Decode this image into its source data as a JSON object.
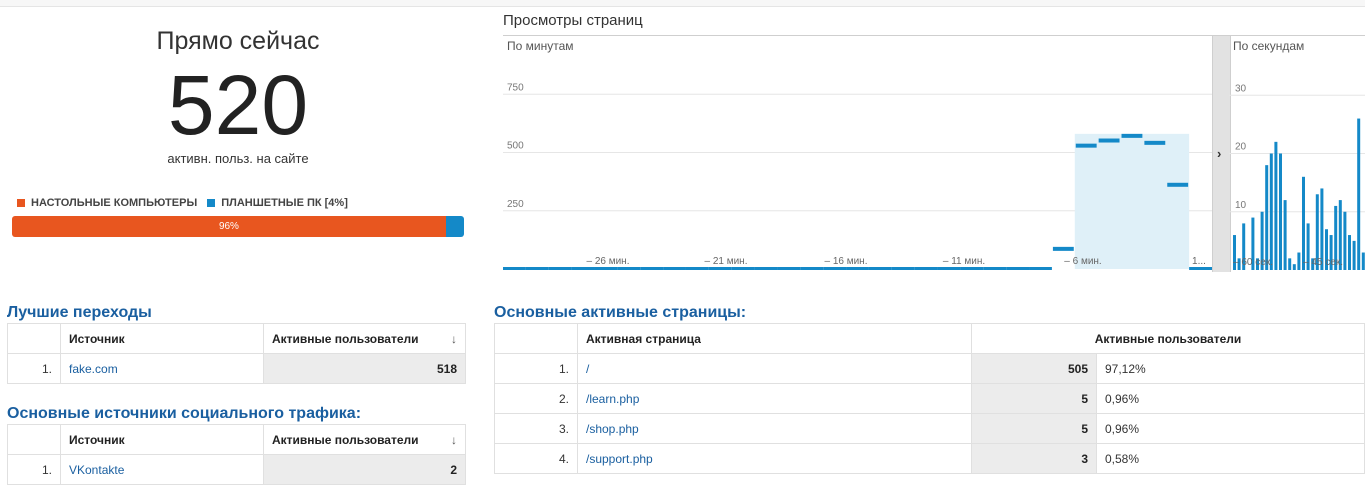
{
  "summary": {
    "title": "Прямо сейчас",
    "count": "520",
    "subtitle": "активн. польз. на сайте",
    "legend": [
      {
        "label": "НАСТОЛЬНЫЕ КОМПЬЮТЕРЫ",
        "color": "#e8561f"
      },
      {
        "label": "ПЛАНШЕТНЫЕ ПК [4%]",
        "color": "#1489c8"
      }
    ],
    "device_share": {
      "desktop_percent": 96,
      "desktop_label": "96%",
      "tablet_percent": 4
    }
  },
  "pageviews": {
    "title": "Просмотры страниц",
    "per_minute_label": "По минутам",
    "per_second_label": "По секундам"
  },
  "chart_data": [
    {
      "type": "bar",
      "title": "По минутам",
      "ylim": [
        0,
        1000
      ],
      "yticks": [
        250,
        500,
        750
      ],
      "xticks": [
        "– 26 мин.",
        "– 21 мин.",
        "– 16 мин.",
        "– 11 мин.",
        "– 6 мин.",
        "1..."
      ],
      "values": [
        0,
        0,
        0,
        0,
        0,
        0,
        0,
        0,
        0,
        0,
        0,
        0,
        0,
        0,
        0,
        0,
        0,
        0,
        0,
        0,
        0,
        0,
        0,
        0,
        95,
        538,
        560,
        580,
        550,
        370,
        0
      ],
      "color": "#1489c8",
      "highlight_fill": "#dff0f8"
    },
    {
      "type": "bar",
      "title": "По секундам",
      "ylim": [
        0,
        40
      ],
      "yticks": [
        10,
        20,
        30
      ],
      "xticks": [
        "– 60 сек.",
        "– 45 сек."
      ],
      "values": [
        6,
        2,
        8,
        0,
        9,
        2,
        10,
        18,
        20,
        22,
        20,
        12,
        2,
        1,
        3,
        16,
        8,
        2,
        13,
        14,
        7,
        6,
        11,
        12,
        10,
        6,
        5,
        26,
        3
      ],
      "color": "#1489c8"
    }
  ],
  "top_referrals": {
    "heading": "Лучшие переходы",
    "col_source": "Источник",
    "col_users": "Активные пользователи",
    "rows": [
      {
        "n": "1.",
        "source": "fake.com",
        "users": "518"
      }
    ]
  },
  "top_social": {
    "heading": "Основные источники социального трафика:",
    "col_source": "Источник",
    "col_users": "Активные пользователи",
    "rows": [
      {
        "n": "1.",
        "source": "VKontakte",
        "users": "2"
      }
    ]
  },
  "top_pages": {
    "heading": "Основные активные страницы:",
    "col_page": "Активная страница",
    "col_users": "Активные пользователи",
    "rows": [
      {
        "n": "1.",
        "page": "/",
        "users": "505",
        "pct": "97,12%"
      },
      {
        "n": "2.",
        "page": "/learn.php",
        "users": "5",
        "pct": "0,96%"
      },
      {
        "n": "3.",
        "page": "/shop.php",
        "users": "5",
        "pct": "0,96%"
      },
      {
        "n": "4.",
        "page": "/support.php",
        "users": "3",
        "pct": "0,58%"
      }
    ]
  }
}
